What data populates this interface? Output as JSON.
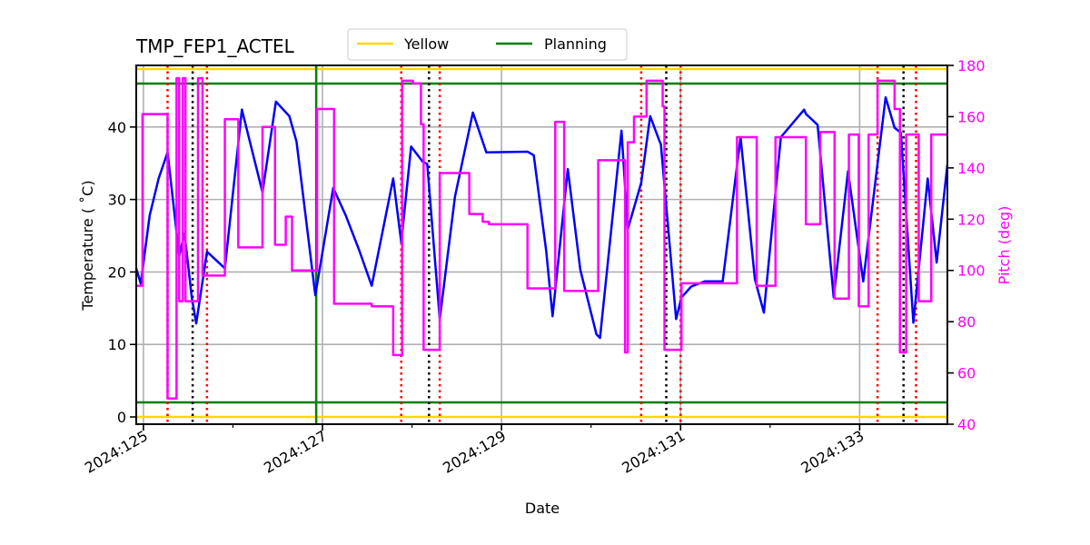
{
  "chart_data": {
    "type": "line",
    "title": "TMP_FEP1_ACTEL",
    "xlabel": "Date",
    "ylabel": "Temperature ($^\\circ$C)",
    "ylabel_display": "Temperature ( ˚C)",
    "y2label": "Pitch (deg)",
    "grid": true,
    "legend_position": "top-center (above plot)",
    "x_unit": "day-of-year 2024",
    "xlim": [
      124.92,
      133.98
    ],
    "ylim": [
      -1,
      48.5
    ],
    "y2lim": [
      40,
      180
    ],
    "x_ticks": [
      {
        "value": 125,
        "label": "2024:125"
      },
      {
        "value": 127,
        "label": "2024:127"
      },
      {
        "value": 129,
        "label": "2024:129"
      },
      {
        "value": 131,
        "label": "2024:131"
      },
      {
        "value": 133,
        "label": "2024:133"
      }
    ],
    "x_minor_ticks": [
      126,
      128,
      130,
      132
    ],
    "y_ticks": [
      0,
      10,
      20,
      30,
      40
    ],
    "y2_ticks": [
      40,
      60,
      80,
      100,
      120,
      140,
      160,
      180
    ],
    "legend": [
      {
        "label": "Yellow",
        "color": "#ffd700"
      },
      {
        "label": "Planning",
        "color": "#008000"
      }
    ],
    "limits": [
      {
        "name": "Yellow",
        "values": [
          0,
          48
        ],
        "color": "#ffd700"
      },
      {
        "name": "Planning",
        "values": [
          2,
          46
        ],
        "color": "#008000"
      }
    ],
    "vertical_lines": [
      {
        "name": "planning-marker",
        "x": 126.93,
        "color": "#008000",
        "style": "solid"
      },
      {
        "name": "red-dotted",
        "x": 125.27,
        "color": "#ff0000",
        "style": "dotted"
      },
      {
        "name": "black-dotted",
        "x": 125.55,
        "color": "#000000",
        "style": "dotted"
      },
      {
        "name": "red-dotted",
        "x": 125.71,
        "color": "#ff0000",
        "style": "dotted"
      },
      {
        "name": "red-dotted",
        "x": 127.88,
        "color": "#ff0000",
        "style": "dotted"
      },
      {
        "name": "black-dotted",
        "x": 128.19,
        "color": "#000000",
        "style": "dotted"
      },
      {
        "name": "red-dotted",
        "x": 128.31,
        "color": "#ff0000",
        "style": "dotted"
      },
      {
        "name": "red-dotted",
        "x": 130.56,
        "color": "#ff0000",
        "style": "dotted"
      },
      {
        "name": "black-dotted",
        "x": 130.84,
        "color": "#000000",
        "style": "dotted"
      },
      {
        "name": "red-dotted",
        "x": 131.0,
        "color": "#ff0000",
        "style": "dotted"
      },
      {
        "name": "red-dotted",
        "x": 133.2,
        "color": "#ff0000",
        "style": "dotted"
      },
      {
        "name": "black-dotted",
        "x": 133.49,
        "color": "#000000",
        "style": "dotted"
      },
      {
        "name": "red-dotted",
        "x": 133.63,
        "color": "#ff0000",
        "style": "dotted"
      }
    ],
    "series": [
      {
        "name": "TMP_FEP1_ACTEL",
        "axis": "left",
        "color": "#0000ff",
        "x": [
          124.92,
          124.97,
          125.07,
          125.17,
          125.27,
          125.4,
          125.46,
          125.54,
          125.59,
          125.71,
          125.91,
          126.1,
          126.33,
          126.48,
          126.63,
          126.71,
          126.92,
          127.12,
          127.26,
          127.41,
          127.55,
          127.79,
          127.88,
          127.99,
          128.12,
          128.17,
          128.31,
          128.48,
          128.68,
          128.83,
          129.29,
          129.36,
          129.5,
          129.57,
          129.74,
          129.88,
          130.06,
          130.1,
          130.34,
          130.41,
          130.56,
          130.66,
          130.76,
          130.78,
          130.95,
          131.01,
          131.12,
          131.27,
          131.47,
          131.67,
          131.83,
          131.93,
          132.12,
          132.38,
          132.4,
          132.53,
          132.71,
          132.87,
          133.04,
          133.29,
          133.39,
          133.46,
          133.6,
          133.76,
          133.86,
          133.98
        ],
        "values": [
          20.5,
          18.4,
          27.8,
          32.9,
          36.5,
          22.2,
          25.3,
          16.5,
          12.9,
          22.8,
          20.5,
          42.4,
          31.0,
          43.5,
          41.5,
          38.0,
          16.8,
          31.6,
          27.8,
          23.0,
          18.1,
          32.9,
          24.1,
          37.3,
          35.2,
          34.9,
          13.5,
          30.4,
          42.0,
          36.5,
          36.6,
          36.1,
          22.8,
          13.9,
          34.2,
          20.3,
          11.4,
          10.9,
          39.5,
          25.9,
          32.3,
          41.5,
          38.2,
          37.6,
          13.5,
          16.5,
          18.0,
          18.7,
          18.7,
          38.6,
          19.0,
          14.4,
          38.6,
          42.4,
          41.8,
          40.3,
          16.5,
          33.9,
          18.7,
          44.1,
          39.9,
          39.2,
          13.0,
          32.9,
          21.3,
          34.8
        ]
      },
      {
        "name": "Pitch",
        "axis": "right",
        "color": "#ff00ff",
        "step": true,
        "x": [
          124.92,
          124.99,
          125.27,
          125.37,
          125.4,
          125.44,
          125.47,
          125.61,
          125.66,
          125.71,
          125.91,
          126.06,
          126.33,
          126.47,
          126.59,
          126.66,
          126.74,
          126.94,
          127.13,
          127.55,
          127.79,
          127.89,
          128.01,
          128.1,
          128.13,
          128.31,
          128.64,
          128.79,
          128.86,
          129.29,
          129.6,
          129.7,
          129.76,
          130.08,
          130.38,
          130.41,
          130.48,
          130.62,
          130.8,
          130.82,
          131.01,
          131.42,
          131.63,
          131.85,
          132.06,
          132.4,
          132.56,
          132.72,
          132.88,
          132.99,
          133.1,
          133.2,
          133.39,
          133.45,
          133.52,
          133.66,
          133.8,
          133.87,
          133.98
        ],
        "values": [
          94,
          161,
          50,
          175,
          88,
          175,
          88,
          175,
          98,
          98,
          159,
          109,
          156,
          110,
          121,
          100,
          100,
          163,
          87,
          86,
          67,
          174,
          173,
          157,
          69,
          138,
          122,
          119,
          118,
          93,
          158,
          92,
          92,
          143,
          68,
          150,
          160,
          174,
          164,
          69,
          95,
          95,
          152,
          94,
          152,
          118,
          154,
          89,
          153,
          86,
          153,
          174,
          163,
          68,
          153,
          88,
          153,
          153,
          153
        ]
      }
    ]
  }
}
